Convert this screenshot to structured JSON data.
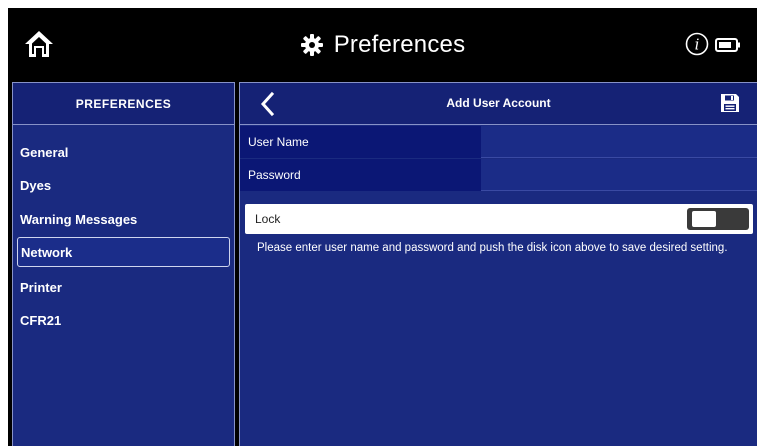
{
  "topbar": {
    "title": "Preferences",
    "icons": {
      "home": "home-icon",
      "title": "gear-icon",
      "info": "info-icon",
      "battery": "battery-icon"
    }
  },
  "sidebar": {
    "header": "PREFERENCES",
    "items": [
      {
        "label": "General",
        "active": false
      },
      {
        "label": "Dyes",
        "active": false
      },
      {
        "label": "Warning Messages",
        "active": false
      },
      {
        "label": "Network",
        "active": true
      },
      {
        "label": "Printer",
        "active": false
      },
      {
        "label": "CFR21",
        "active": false
      }
    ]
  },
  "main": {
    "title": "Add User Account",
    "icons": {
      "back": "chevron-left-icon",
      "save": "floppy-disk-icon"
    },
    "fields": {
      "username": {
        "label": "User Name",
        "value": ""
      },
      "password": {
        "label": "Password",
        "value": ""
      }
    },
    "lock": {
      "label": "Lock",
      "on": false
    },
    "info": "Please enter user name and password and push the disk icon above to save desired setting."
  },
  "colors": {
    "panel": "#1a2a80",
    "header": "#152275",
    "label_cell": "#0b1775",
    "topbar": "#000000",
    "toggle_off": "#3a3a3a"
  }
}
